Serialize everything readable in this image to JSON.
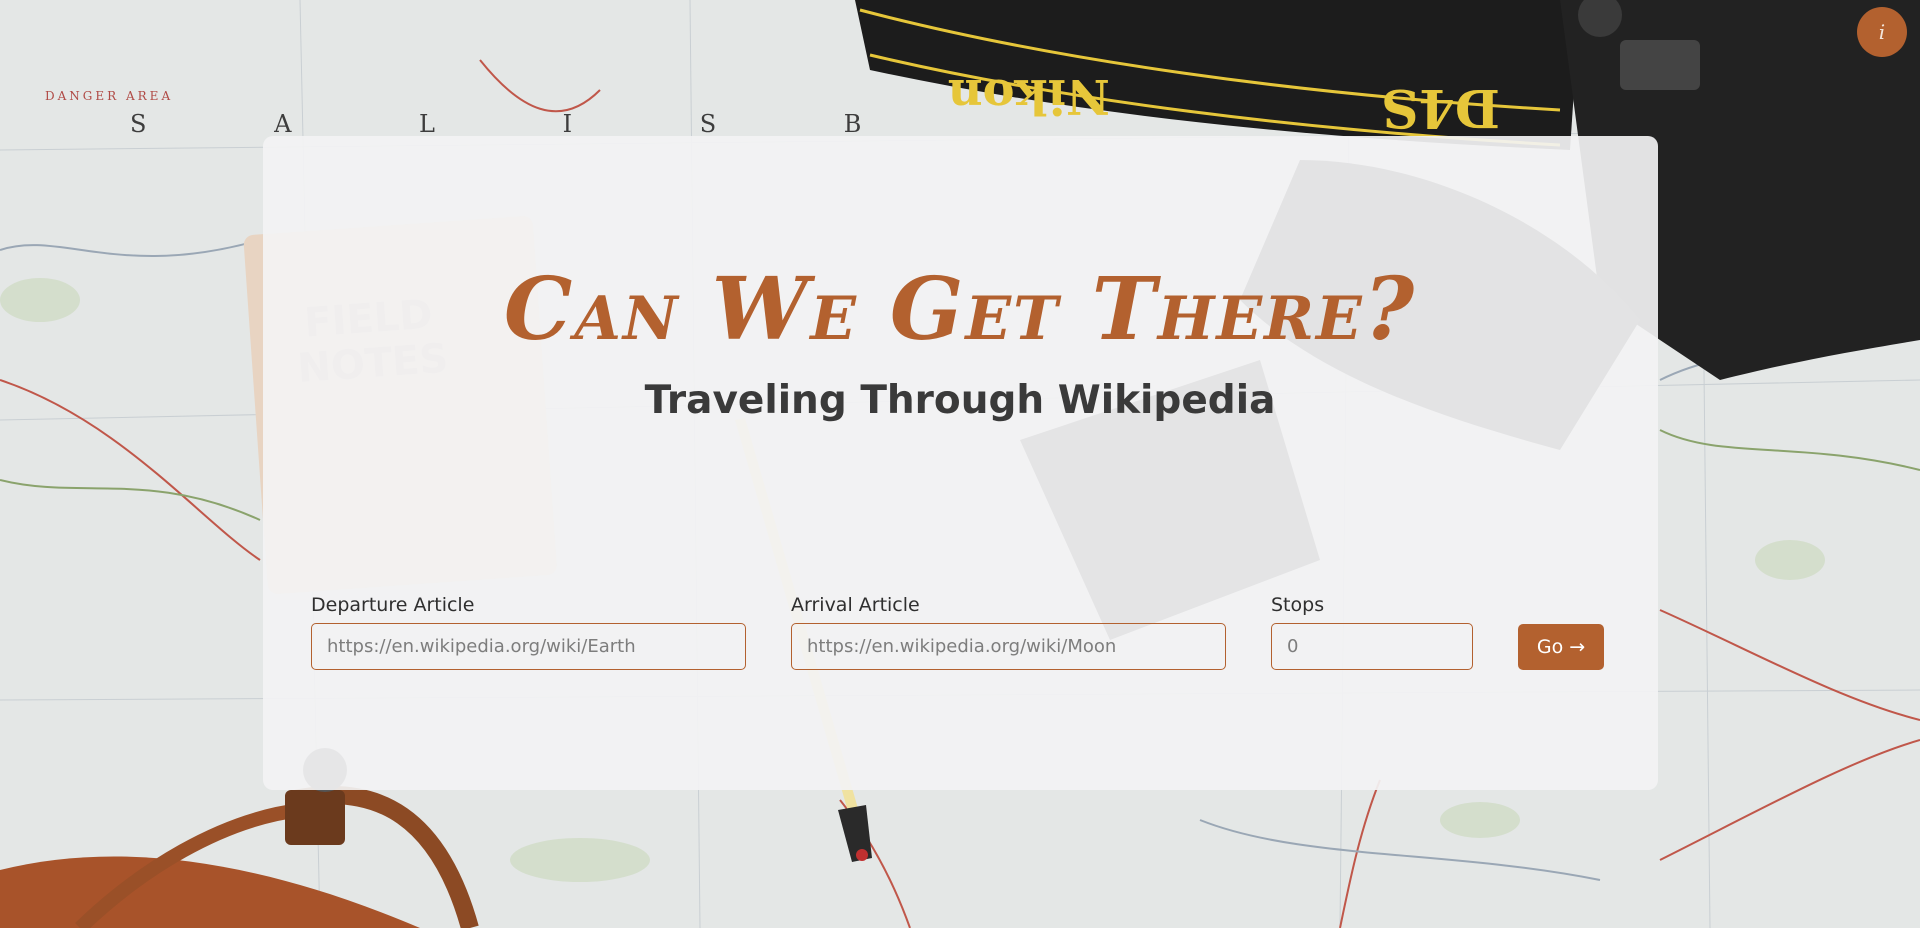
{
  "app": {
    "title": "Can We Get There?",
    "subtitle": "Traveling Through Wikipedia",
    "info_label": "i"
  },
  "form": {
    "departure": {
      "label": "Departure Article",
      "placeholder": "https://en.wikipedia.org/wiki/Earth",
      "value": ""
    },
    "arrival": {
      "label": "Arrival Article",
      "placeholder": "https://en.wikipedia.org/wiki/Moon",
      "value": ""
    },
    "stops": {
      "label": "Stops",
      "placeholder": "0",
      "value": ""
    },
    "go": {
      "label": "Go",
      "icon": "arrow-right-icon",
      "icon_glyph": "→"
    }
  },
  "background": {
    "description_icons": [
      "map",
      "camera",
      "notebook",
      "pencil",
      "leather-bag"
    ],
    "camera_strap_text": [
      "Nikon",
      "D4S"
    ],
    "notebook_text": [
      "FIELD",
      "NOTES"
    ],
    "map_text": [
      "DANGER AREA",
      "S",
      "A",
      "L",
      "I",
      "S",
      "B"
    ]
  },
  "colors": {
    "accent": "#b3612f",
    "card": "#f3f3f4",
    "text": "#3a3a3a"
  }
}
